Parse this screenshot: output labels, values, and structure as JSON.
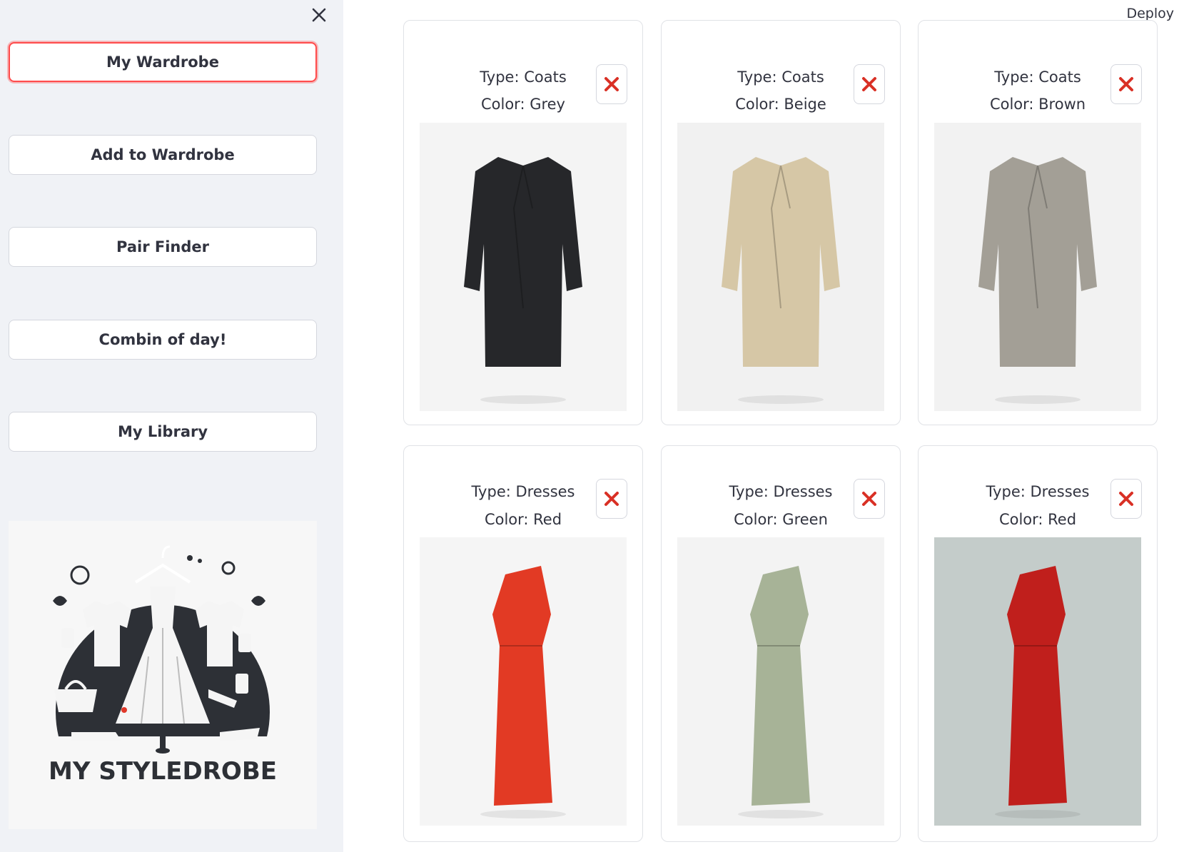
{
  "sidebar": {
    "nav": [
      "My Wardrobe",
      "Add to Wardrobe",
      "Pair Finder",
      "Combin of day!",
      "My Library"
    ],
    "logo_text": "MY STYLEDROBE"
  },
  "header": {
    "deploy_label": "Deploy"
  },
  "colors": {
    "accent": "#ff4b4b",
    "sidebar_bg": "#f0f2f6",
    "delete": "#d93025",
    "text": "#31333f"
  },
  "items": [
    {
      "type": "Type: Coats",
      "color": "Color: Grey",
      "garment": "coat",
      "swatch": "#26272a",
      "background": "#f4f4f4"
    },
    {
      "type": "Type: Coats",
      "color": "Color: Beige",
      "garment": "coat",
      "swatch": "#d6c7a6",
      "background": "#f1f1f1"
    },
    {
      "type": "Type: Coats",
      "color": "Color: Brown",
      "garment": "coat",
      "swatch": "#a39f96",
      "background": "#f2f2f2"
    },
    {
      "type": "Type: Dresses",
      "color": "Color: Red",
      "garment": "dress",
      "swatch": "#e23a24",
      "background": "#f5f5f5"
    },
    {
      "type": "Type: Dresses",
      "color": "Color: Green",
      "garment": "dress",
      "swatch": "#a7b397",
      "background": "#f3f3f3"
    },
    {
      "type": "Type: Dresses",
      "color": "Color: Red",
      "garment": "dress",
      "swatch": "#c01f1c",
      "background": "#c4ccca"
    }
  ]
}
